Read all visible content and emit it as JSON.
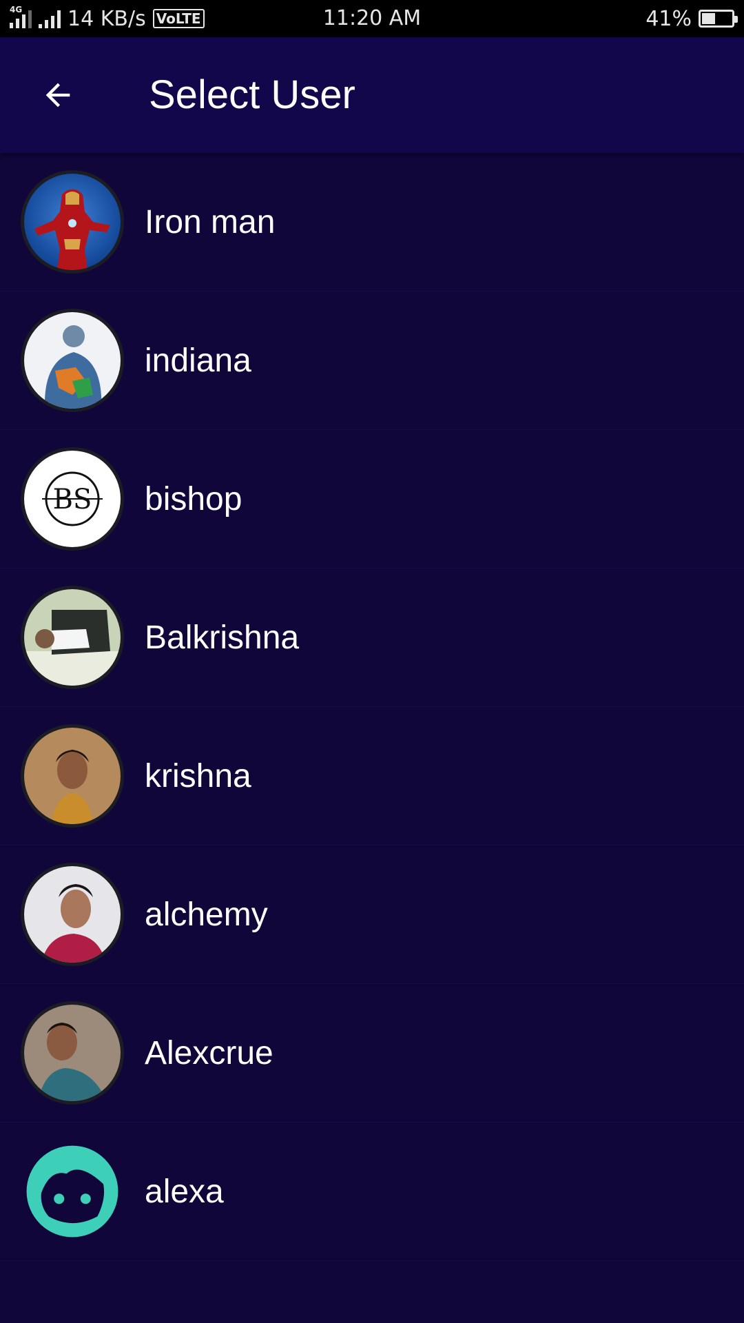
{
  "status_bar": {
    "network_type": "4G",
    "net_speed": "14 KB/s",
    "volte": "VoLTE",
    "time": "11:20 AM",
    "battery_percent": "41%",
    "battery_level": 0.41
  },
  "header": {
    "back_icon": "arrow-left-icon",
    "title": "Select User"
  },
  "users": [
    {
      "name": "Iron man"
    },
    {
      "name": "indiana"
    },
    {
      "name": "bishop",
      "avatar_text": "BS"
    },
    {
      "name": "Balkrishna"
    },
    {
      "name": "krishna"
    },
    {
      "name": "alchemy"
    },
    {
      "name": "Alexcrue"
    },
    {
      "name": "alexa"
    }
  ],
  "colors": {
    "background": "#10063a",
    "app_bar": "#12074a",
    "default_avatar": "#3ecfb8"
  }
}
